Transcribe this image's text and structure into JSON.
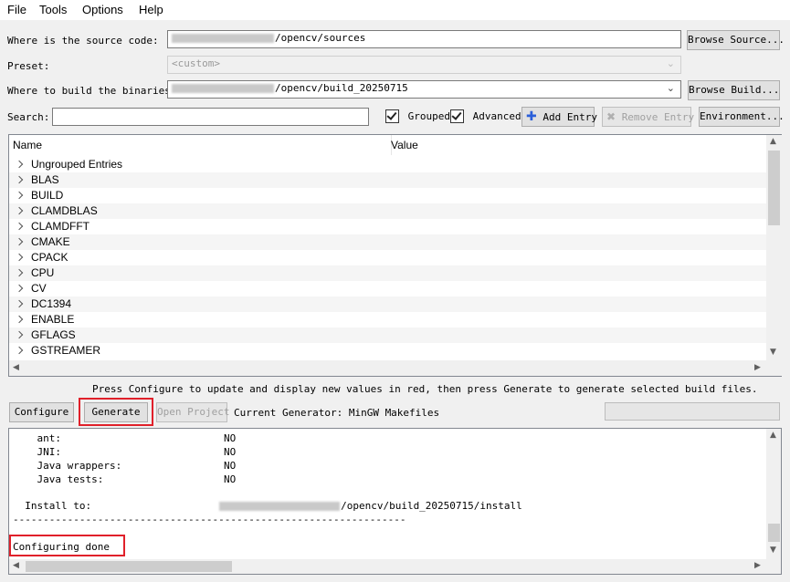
{
  "menu": {
    "file": "File",
    "tools": "Tools",
    "options": "Options",
    "help": "Help"
  },
  "source": {
    "label": "Where is the source code:",
    "value_suffix": "/opencv/sources",
    "browse": "Browse Source..."
  },
  "preset": {
    "label": "Preset:",
    "value": "<custom>"
  },
  "build": {
    "label": "Where to build the binaries:",
    "value_suffix": "/opencv/build_20250715",
    "browse": "Browse Build..."
  },
  "search": {
    "label": "Search:",
    "value": ""
  },
  "options": {
    "grouped": "Grouped",
    "advanced": "Advanced",
    "add_entry": "Add Entry",
    "remove_entry": "Remove Entry",
    "environment": "Environment..."
  },
  "table": {
    "headers": [
      "Name",
      "Value"
    ],
    "rows": [
      "Ungrouped Entries",
      "BLAS",
      "BUILD",
      "CLAMDBLAS",
      "CLAMDFFT",
      "CMAKE",
      "CPACK",
      "CPU",
      "CV",
      "DC1394",
      "ENABLE",
      "GFLAGS",
      "GSTREAMER"
    ]
  },
  "hint": "Press Configure to update and display new values in red, then press Generate to generate selected build files.",
  "actions": {
    "configure": "Configure",
    "generate": "Generate",
    "open_project": "Open Project",
    "generator": "Current Generator: MinGW Makefiles"
  },
  "log": {
    "lines": [
      {
        "name": "    ant:",
        "value": "NO"
      },
      {
        "name": "    JNI:",
        "value": "NO"
      },
      {
        "name": "    Java wrappers:",
        "value": "NO"
      },
      {
        "name": "    Java tests:",
        "value": "NO"
      }
    ],
    "install_label": "  Install to:",
    "install_suffix": "/opencv/build_20250715/install",
    "separator": "-----------------------------------------------------------------",
    "done": "Configuring done"
  },
  "colors": {
    "highlight_box": "#e0202a",
    "add_icon": "#2b5fd9"
  }
}
